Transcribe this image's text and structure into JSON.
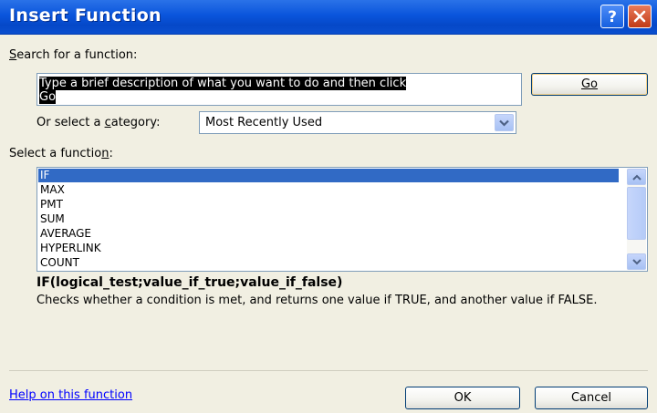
{
  "window": {
    "title": "Insert Function",
    "help_icon": "question-mark-icon",
    "close_icon": "close-x-icon"
  },
  "search": {
    "label": "Search for a function:",
    "label_accel": "S",
    "label_rest": "earch for a function:",
    "value_line1": "Type a brief description of what you want to do and then click",
    "value_line2": "Go",
    "go_label": "Go"
  },
  "category": {
    "label_pre": "Or select a ",
    "label_accel": "c",
    "label_post": "ategory:",
    "selected": "Most Recently Used",
    "arrow_icon": "chevron-down-icon"
  },
  "functions": {
    "label_pre": "Select a functio",
    "label_accel": "n",
    "label_post": ":",
    "items": [
      "IF",
      "MAX",
      "PMT",
      "SUM",
      "AVERAGE",
      "HYPERLINK",
      "COUNT"
    ],
    "selected_index": 0
  },
  "details": {
    "signature": "IF(logical_test;value_if_true;value_if_false)",
    "description": "Checks whether a condition is met, and returns one value if TRUE, and another value if FALSE."
  },
  "footer": {
    "help_link": "Help on this function",
    "ok_label": "OK",
    "cancel_label": "Cancel"
  },
  "colors": {
    "titlebar": "#0a55dc",
    "selection": "#316ac5",
    "dialog_bg": "#f1efe2",
    "link": "#0000ff"
  }
}
